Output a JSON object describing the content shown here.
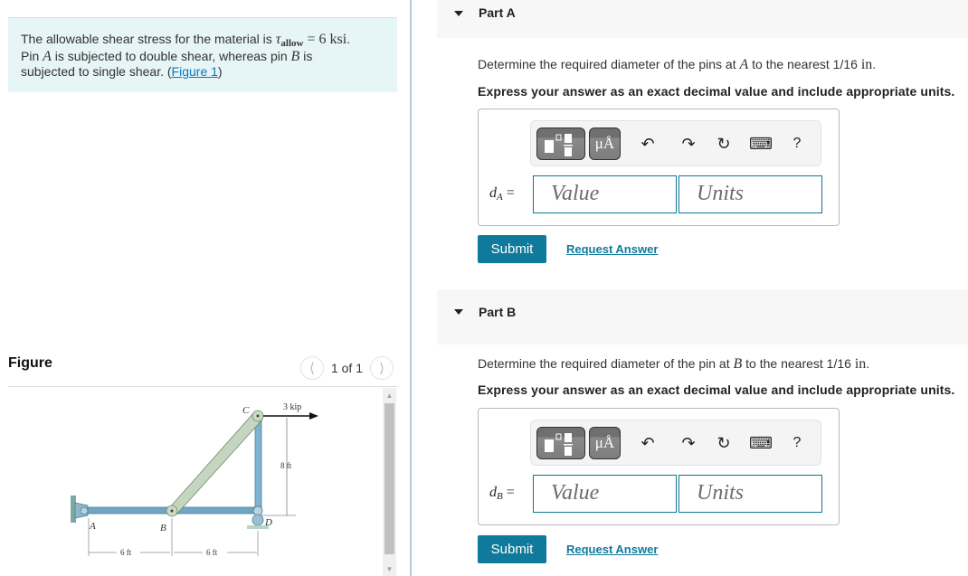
{
  "problem": {
    "line1_prefix": "The allowable shear stress for the material is ",
    "tau_symbol": "τ",
    "tau_sub": "allow",
    "equals": " = 6 ksi",
    "line1_suffix": ".",
    "line2_prefix": "Pin ",
    "pin_a": "A",
    "line2_mid": " is subjected to double shear, whereas pin ",
    "pin_b": "B",
    "line2_suffix": " is",
    "line3": "subjected to single shear. (",
    "figure_link": "Figure 1",
    "line3_suffix": ")"
  },
  "figure": {
    "title": "Figure",
    "pager_text": "1 of 1",
    "prev_icon": "chevron-left",
    "next_icon": "chevron-right",
    "labels": {
      "A": "A",
      "B": "B",
      "C": "C",
      "D": "D",
      "load": "3 kip",
      "height": "8 ft",
      "span1": "6 ft",
      "span2": "6 ft"
    }
  },
  "parts": [
    {
      "title": "Part A",
      "question_prefix": "Determine the required diameter of the pins at ",
      "question_var": "A",
      "question_mid": " to the nearest 1/16 ",
      "question_unit": "in",
      "question_suffix": ".",
      "instruction": "Express your answer as an exact decimal value and include appropriate units.",
      "answer_var": "d",
      "answer_sub": "A",
      "answer_eq": " =",
      "value_placeholder": "Value",
      "units_placeholder": "Units",
      "units_button": "μÅ",
      "submit": "Submit",
      "request": "Request Answer"
    },
    {
      "title": "Part B",
      "question_prefix": "Determine the required diameter of the pin at ",
      "question_var": "B",
      "question_mid": " to the nearest 1/16 ",
      "question_unit": "in",
      "question_suffix": ".",
      "instruction": "Express your answer as an exact decimal value and include appropriate units.",
      "answer_var": "d",
      "answer_sub": "B",
      "answer_eq": " =",
      "value_placeholder": "Value",
      "units_placeholder": "Units",
      "units_button": "μÅ",
      "submit": "Submit",
      "request": "Request Answer"
    }
  ],
  "toolbar": {
    "undo_icon": "↶",
    "redo_icon": "↷",
    "reset_icon": "↻",
    "keyboard_icon": "⌨",
    "help_icon": "?"
  },
  "colors": {
    "accent": "#0f7a9c",
    "link": "#1276b8",
    "problem_bg": "#e6f5f6",
    "header_bg": "#f7f7f7"
  }
}
